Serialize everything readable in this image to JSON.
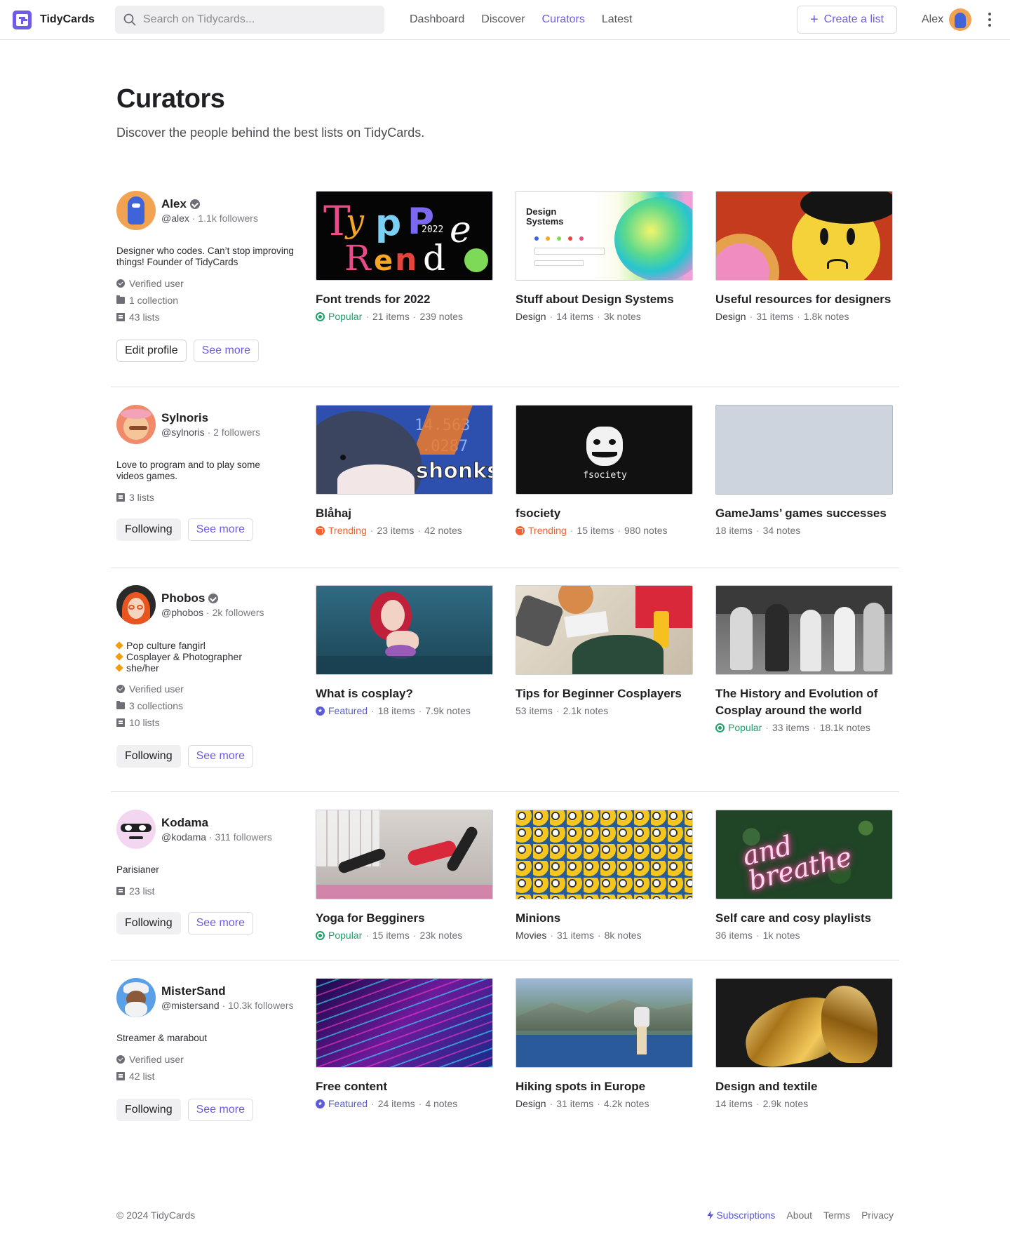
{
  "app": {
    "name": "TidyCards"
  },
  "search": {
    "placeholder": "Search on Tidycards..."
  },
  "nav": [
    {
      "label": "Dashboard",
      "active": false
    },
    {
      "label": "Discover",
      "active": false
    },
    {
      "label": "Curators",
      "active": true
    },
    {
      "label": "Latest",
      "active": false
    }
  ],
  "header": {
    "create_label": "Create a list",
    "user_name": "Alex"
  },
  "page": {
    "title": "Curators",
    "subtitle": "Discover the people behind the best lists on TidyCards."
  },
  "curators": [
    {
      "name": "Alex",
      "verified_badge": true,
      "handle": "@alex",
      "followers": "1.1k followers",
      "bio": "Designer who codes. Can’t stop improving things! Founder of TidyCards",
      "meta": [
        {
          "icon": "verified-icon",
          "text": "Verified user"
        },
        {
          "icon": "folder-icon",
          "text": "1 collection"
        },
        {
          "icon": "list-icon",
          "text": "43 lists"
        }
      ],
      "primary_button": "Edit profile",
      "secondary_button": "See more",
      "cards": [
        {
          "title": "Font trends for 2022",
          "badge": "Popular",
          "badge_type": "popular",
          "category": "",
          "items": "21 items",
          "notes": "239 notes"
        },
        {
          "title": "Stuff about Design Systems",
          "badge": "",
          "badge_type": "",
          "category": "Design",
          "items": "14 items",
          "notes": "3k notes"
        },
        {
          "title": "Useful resources for designers",
          "badge": "",
          "badge_type": "",
          "category": "Design",
          "items": "31 items",
          "notes": "1.8k notes"
        }
      ]
    },
    {
      "name": "Sylnoris",
      "verified_badge": false,
      "handle": "@sylnoris",
      "followers": "2 followers",
      "bio": "Love to program and to play some videos games.",
      "meta": [
        {
          "icon": "list-icon",
          "text": "3 lists"
        }
      ],
      "primary_button": "Following",
      "secondary_button": "See more",
      "cards": [
        {
          "title": "Blåhaj",
          "badge": "Trending",
          "badge_type": "trending",
          "category": "",
          "items": "23 items",
          "notes": "42 notes"
        },
        {
          "title": "fsociety",
          "badge": "Trending",
          "badge_type": "trending",
          "category": "",
          "items": "15 items",
          "notes": "980 notes"
        },
        {
          "title": "GameJams’ games successes",
          "badge": "",
          "badge_type": "",
          "category": "",
          "items": "18 items",
          "notes": "34 notes"
        }
      ]
    },
    {
      "name": "Phobos",
      "verified_badge": true,
      "handle": "@phobos",
      "followers": "2k followers",
      "bio_lines": [
        "Pop culture fangirl",
        "Cosplayer & Photographer",
        "she/her"
      ],
      "meta": [
        {
          "icon": "verified-icon",
          "text": "Verified user"
        },
        {
          "icon": "folder-icon",
          "text": "3 collections"
        },
        {
          "icon": "list-icon",
          "text": "10 lists"
        }
      ],
      "primary_button": "Following",
      "secondary_button": "See more",
      "cards": [
        {
          "title": "What is cosplay?",
          "badge": "Featured",
          "badge_type": "featured",
          "category": "",
          "items": "18 items",
          "notes": "7.9k notes"
        },
        {
          "title": "Tips for Beginner Cosplayers",
          "badge": "",
          "badge_type": "",
          "category": "",
          "items": "53 items",
          "notes": "2.1k notes"
        },
        {
          "title": "The History and Evolution of Cosplay around the world",
          "badge": "Popular",
          "badge_type": "popular",
          "category": "",
          "items": "33 items",
          "notes": "18.1k notes"
        }
      ]
    },
    {
      "name": "Kodama",
      "verified_badge": false,
      "handle": "@kodama",
      "followers": "311 followers",
      "bio": "Parisianer",
      "meta": [
        {
          "icon": "list-icon",
          "text": "23 list"
        }
      ],
      "primary_button": "Following",
      "secondary_button": "See more",
      "cards": [
        {
          "title": "Yoga for Begginers",
          "badge": "Popular",
          "badge_type": "popular",
          "category": "",
          "items": "15 items",
          "notes": "23k notes"
        },
        {
          "title": "Minions",
          "badge": "",
          "badge_type": "",
          "category": "Movies",
          "items": "31 items",
          "notes": "8k notes"
        },
        {
          "title": "Self care and cosy playlists",
          "badge": "",
          "badge_type": "",
          "category": "",
          "items": "36 items",
          "notes": "1k notes"
        }
      ]
    },
    {
      "name": "MisterSand",
      "verified_badge": false,
      "handle": "@mistersand",
      "followers": "10.3k followers",
      "bio": "Streamer & marabout",
      "meta": [
        {
          "icon": "verified-icon",
          "text": "Verified user"
        },
        {
          "icon": "list-icon",
          "text": "42 list"
        }
      ],
      "primary_button": "Following",
      "secondary_button": "See more",
      "cards": [
        {
          "title": "Free content",
          "badge": "Featured",
          "badge_type": "featured",
          "category": "",
          "items": "24 items",
          "notes": "4 notes"
        },
        {
          "title": "Hiking spots in Europe",
          "badge": "",
          "badge_type": "",
          "category": "Design",
          "items": "31 items",
          "notes": "4.2k notes"
        },
        {
          "title": "Design and textile",
          "badge": "",
          "badge_type": "",
          "category": "",
          "items": "14 items",
          "notes": "2.9k notes"
        }
      ]
    }
  ],
  "thumb_text": {
    "design_systems": "Design Systems",
    "shark_overlay": "shonks",
    "fsociety_caption": "fsociety",
    "font_year": "2022",
    "neon": "and breathe"
  },
  "footer": {
    "copyright": "© 2024 TidyCards",
    "links": [
      "Subscriptions",
      "About",
      "Terms",
      "Privacy"
    ]
  },
  "colors": {
    "accent": "#6c5ce7",
    "popular": "#20a06a",
    "trending": "#f0622f",
    "featured": "#5b5bd6"
  }
}
